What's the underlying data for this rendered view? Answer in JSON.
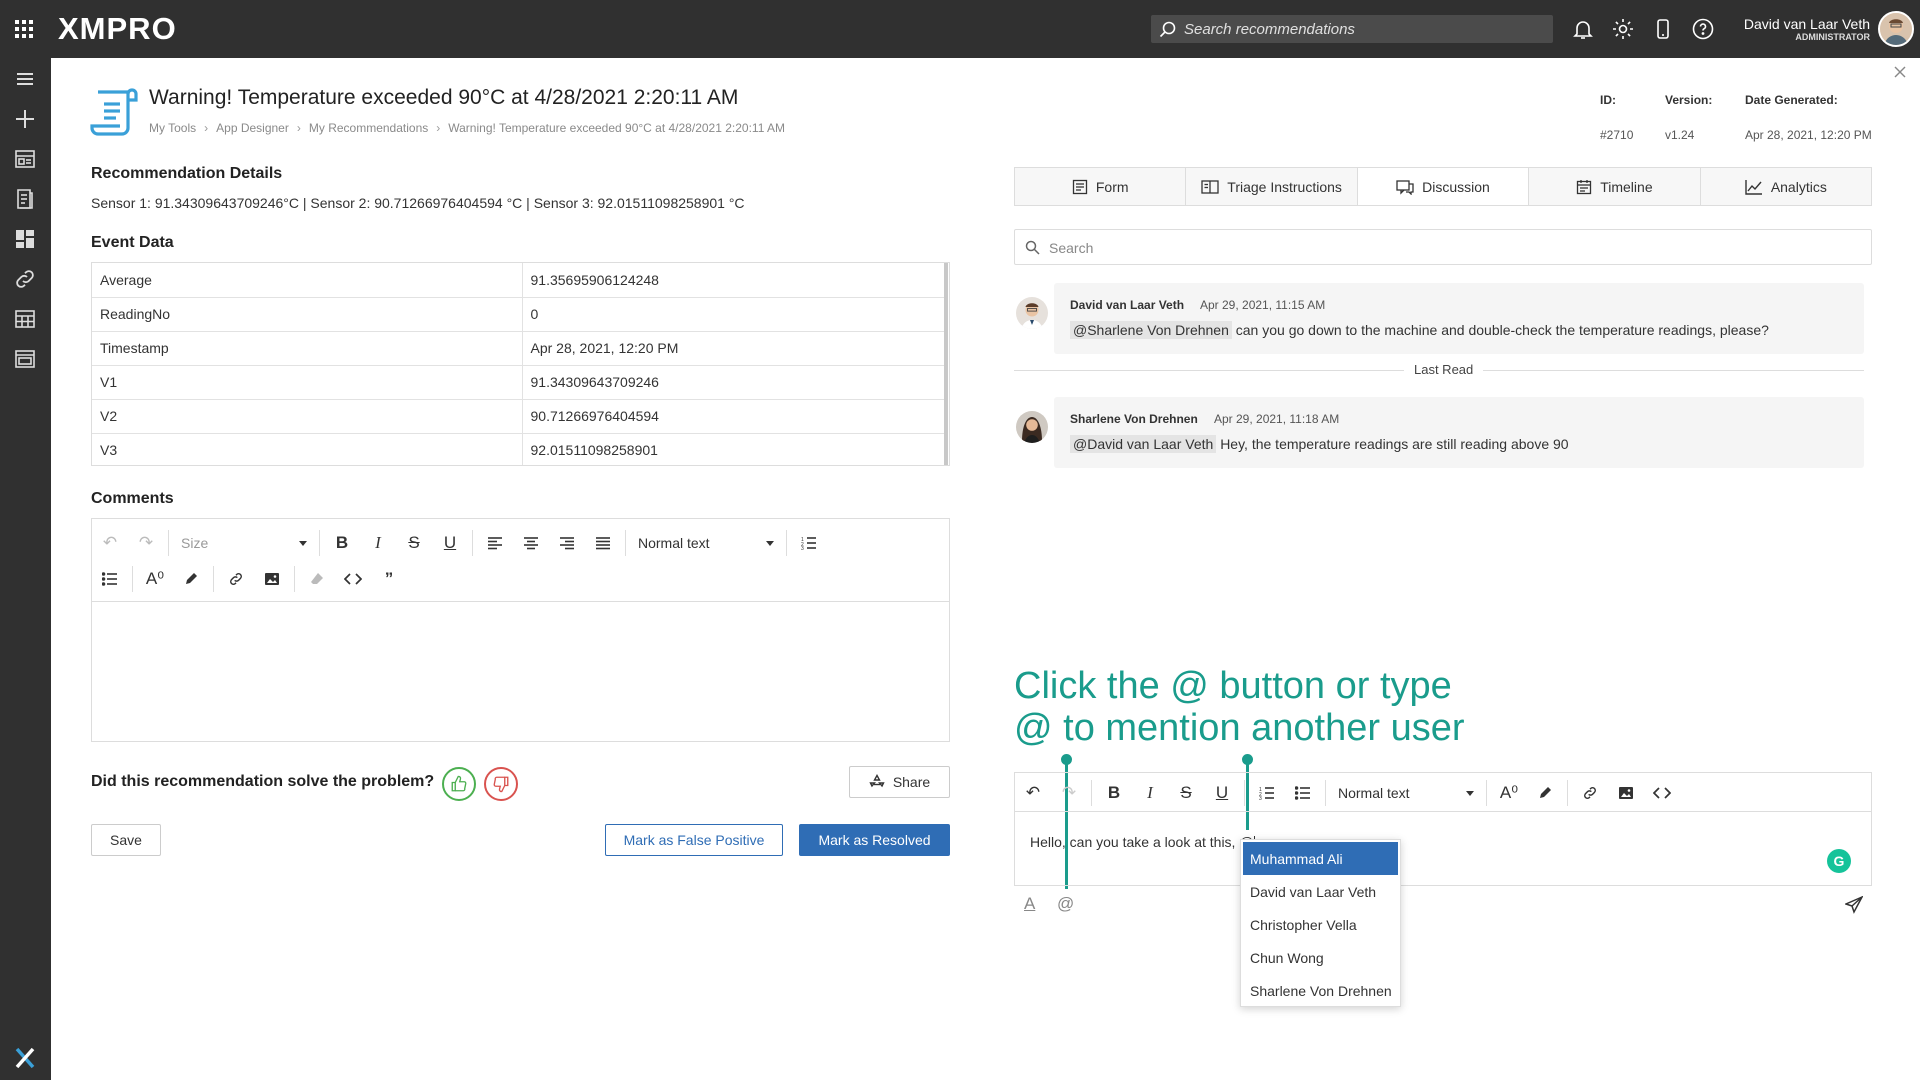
{
  "topbar": {
    "logo": "XMPRO",
    "search_placeholder": "Search recommendations",
    "user_name": "David van Laar Veth",
    "user_role": "ADMINISTRATOR",
    "icons": [
      "apps-grid-icon",
      "search-icon",
      "bell-icon",
      "gear-icon",
      "mobile-icon",
      "help-icon"
    ]
  },
  "sidebar": {
    "icons": [
      "hamburger-icon",
      "plus-icon",
      "app-designer-icon",
      "recommendations-icon",
      "dashboard-icon",
      "link-icon",
      "data-stream-icon",
      "app-icon",
      "xmpro-x-icon"
    ]
  },
  "header": {
    "title": "Warning! Temperature exceeded 90°C at 4/28/2021 2:20:11 AM",
    "breadcrumb": [
      "My Tools",
      "App Designer",
      "My Recommendations",
      "Warning! Temperature exceeded 90°C at 4/28/2021 2:20:11 AM"
    ],
    "meta": [
      {
        "label": "ID:",
        "value": "#2710"
      },
      {
        "label": "Version:",
        "value": "v1.24"
      },
      {
        "label": "Date Generated:",
        "value": "Apr 28, 2021, 12:20 PM"
      }
    ]
  },
  "details": {
    "title": "Recommendation Details",
    "text": "Sensor 1: 91.34309643709246°C | Sensor 2: 90.71266976404594 °C | Sensor 3: 92.01511098258901 °C"
  },
  "event_data": {
    "title": "Event Data",
    "rows": [
      {
        "key": "Average",
        "value": "91.35695906124248"
      },
      {
        "key": "ReadingNo",
        "value": "0"
      },
      {
        "key": "Timestamp",
        "value": "Apr 28, 2021, 12:20 PM"
      },
      {
        "key": "V1",
        "value": "91.34309643709246"
      },
      {
        "key": "V2",
        "value": "90.71266976404594"
      },
      {
        "key": "V3",
        "value": "92.01511098258901"
      }
    ]
  },
  "comments": {
    "title": "Comments",
    "size_select": "Size",
    "format_select": "Normal text"
  },
  "solve": {
    "question": "Did this recommendation solve the problem?",
    "share_label": "Share"
  },
  "actions": {
    "save": "Save",
    "false_positive": "Mark as False Positive",
    "resolved": "Mark as Resolved"
  },
  "tabs": [
    {
      "label": "Form",
      "icon": "form-icon"
    },
    {
      "label": "Triage Instructions",
      "icon": "book-icon"
    },
    {
      "label": "Discussion",
      "icon": "discussion-icon"
    },
    {
      "label": "Timeline",
      "icon": "timeline-icon"
    },
    {
      "label": "Analytics",
      "icon": "analytics-icon"
    }
  ],
  "discussion": {
    "search_placeholder": "Search",
    "last_read": "Last Read",
    "messages": [
      {
        "author": "David van Laar Veth",
        "time": "Apr 29, 2021, 11:15 AM",
        "mention": "@Sharlene Von Drehnen",
        "text": "can you go down to the machine and double-check the temperature readings, please?"
      },
      {
        "author": "Sharlene Von Drehnen",
        "time": "Apr 29, 2021, 11:18 AM",
        "mention": "@David van Laar Veth",
        "text": "Hey, the temperature readings are still reading above 90"
      }
    ]
  },
  "callout": {
    "line1": "Click the @ button or type",
    "line2": "@ to mention another user"
  },
  "reply_editor": {
    "format_select": "Normal text",
    "typed_text": "Hello, can you take a look at this, @",
    "grammarly": "G"
  },
  "mention_list": [
    "Muhammad Ali",
    "David van Laar Veth",
    "Christopher Vella",
    "Chun Wong",
    "Sharlene Von Drehnen"
  ],
  "colors": {
    "topbar": "#303030",
    "primary": "#2f6db5",
    "callout": "#1a9c8c",
    "thumb_up": "#4caf50",
    "thumb_down": "#d9534f"
  }
}
